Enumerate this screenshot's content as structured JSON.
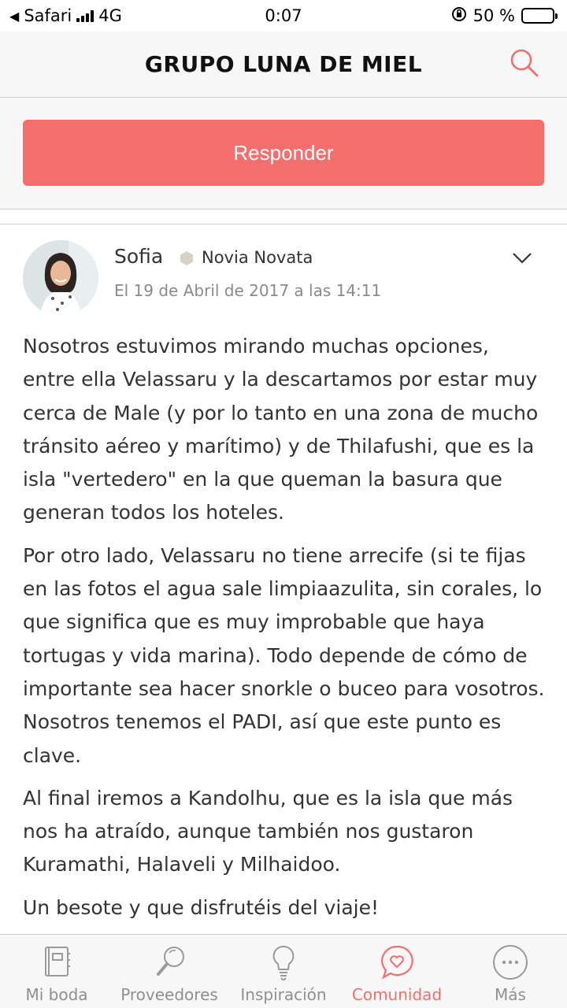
{
  "status_bar": {
    "back_app": "Safari",
    "network": "4G",
    "time": "0:07",
    "battery_text": "50 %"
  },
  "header": {
    "title": "GRUPO LUNA DE MIEL"
  },
  "reply": {
    "label": "Responder"
  },
  "post": {
    "author": "Sofia",
    "rank": "Novia Novata",
    "date": "El 19 de Abril de 2017 a las 14:11",
    "paragraphs": [
      "Nosotros estuvimos mirando muchas opciones, entre ella Velassaru y la descartamos por estar muy cerca de Male (y por lo tanto en una zona de mucho tránsito aéreo y marítimo) y de Thilafushi, que es la isla \"vertedero\" en la que queman la basura que generan todos los hoteles.",
      "Por otro lado, Velassaru no tiene arrecife (si te fijas en las fotos el agua sale limpiaazulita, sin corales, lo que significa que es muy improbable que haya tortugas y vida marina). Todo depende de cómo de importante sea hacer snorkle o buceo para vosotros. Nosotros tenemos el PADI, así que este punto es clave.",
      "Al final iremos a Kandolhu, que es la isla que más nos ha atraído, aunque también nos gustaron Kuramathi, Halaveli y Milhaidoo.",
      "Un besote y que disfrutéis del viaje!"
    ]
  },
  "tabs": [
    {
      "label": "Mi boda",
      "icon": "notebook-icon"
    },
    {
      "label": "Proveedores",
      "icon": "magnifier-icon"
    },
    {
      "label": "Inspiración",
      "icon": "lightbulb-icon"
    },
    {
      "label": "Comunidad",
      "icon": "heart-chat-icon"
    },
    {
      "label": "Más",
      "icon": "more-dots-icon"
    }
  ],
  "colors": {
    "accent": "#f46e6e",
    "tab_inactive": "#8f8f8f",
    "header_bg": "#f7f7f7"
  }
}
